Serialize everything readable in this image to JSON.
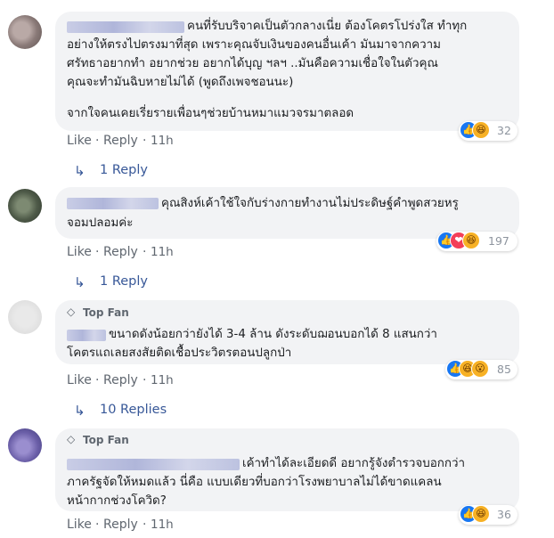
{
  "comments": [
    {
      "top_fan": false,
      "text_lines": [
        "คนที่รับบริจาคเป็นตัวกลางเนี่ย ต้องโคตรโปร่งใส ทำทุก",
        "อย่างให้ตรงไปตรงมาที่สุด เพราะคุณจับเงินของคนอื่นเค้า มันมาจากความ",
        "ศรัทธาอยากทำ อยากช่วย อยากได้บุญ ฯลฯ ..มันคือความเชื่อใจในตัวคุณ",
        "คุณจะทำมันฉิบหายไม่ได้ (พูดถึงเพจชอนนะ)",
        "",
        "จากใจคนเคยเรี่ยรายเพื่อนๆช่วยบ้านหมาแมวจรมาตลอด"
      ],
      "like_label": "Like",
      "reply_label": "Reply",
      "time": "11h",
      "reaction_count": "32",
      "reactions": [
        "like-icon",
        "haha-icon"
      ],
      "replies_label": "1 Reply"
    },
    {
      "top_fan": false,
      "text_lines": [
        "คุณสิงห์เค้าใช้ใจกับร่างกายทำงานไม่ประดิษฐ์คำพูดสวยหรู",
        "จอมปลอมค่ะ"
      ],
      "like_label": "Like",
      "reply_label": "Reply",
      "time": "11h",
      "reaction_count": "197",
      "reactions": [
        "like-icon",
        "love-icon",
        "haha-icon"
      ],
      "replies_label": "1 Reply"
    },
    {
      "top_fan": true,
      "top_fan_label": "Top Fan",
      "text_lines": [
        "ขนาดดังน้อยกว่ายังได้ 3-4 ล้าน ดังระดับฌอนบอกได้ 8 แสนกว่า",
        "โคตรแถเลยสงสัยติดเชื้อประวิตรตอนปลูกป่า"
      ],
      "like_label": "Like",
      "reply_label": "Reply",
      "time": "11h",
      "reaction_count": "85",
      "reactions": [
        "like-icon",
        "haha-icon",
        "wow-icon"
      ],
      "replies_label": "10 Replies"
    },
    {
      "top_fan": true,
      "top_fan_label": "Top Fan",
      "text_lines": [
        "เค้าทำได้ละเอียดดี อยากรู้จังตำรวจบอกกว่า",
        "ภาครัฐจัดให้หมดแล้ว นี่คือ แบบเดียวที่บอกว่าโรงพยาบาลไม่ได้ขาดแคลน",
        "หน้ากากช่วงโควิด?"
      ],
      "like_label": "Like",
      "reply_label": "Reply",
      "time": "11h",
      "reaction_count": "36",
      "reactions": [
        "like-icon",
        "haha-icon"
      ]
    }
  ],
  "colors": {
    "bubble": "#f2f3f5",
    "link": "#385898",
    "meta": "#606770",
    "like": "#1877f2",
    "love": "#f33e58",
    "haha": "#f7b125"
  }
}
